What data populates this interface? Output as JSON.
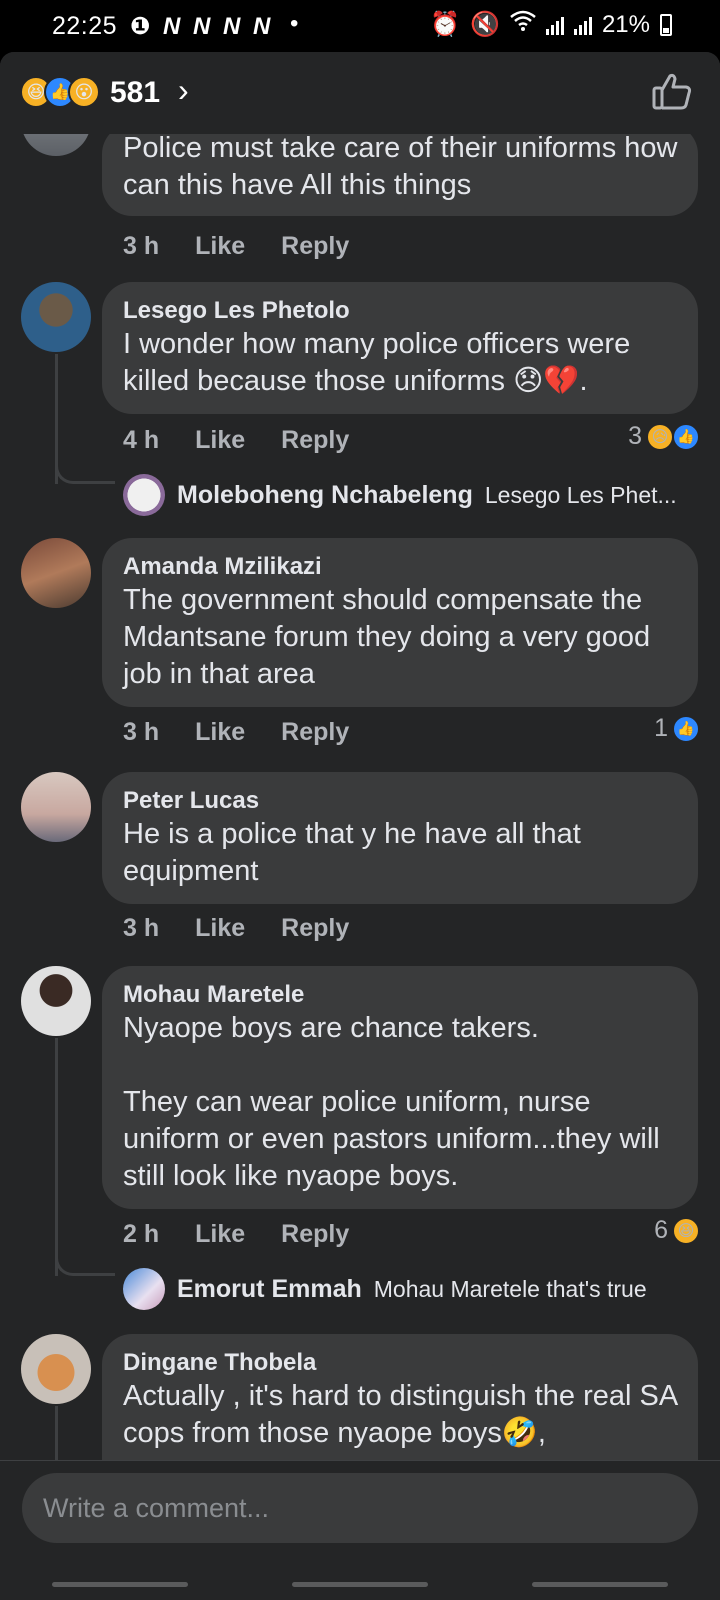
{
  "status_bar": {
    "time": "22:25",
    "notifications": "❶ N N N N",
    "dot": "•",
    "battery": "21%"
  },
  "header": {
    "reactions": [
      "haha-icon",
      "like-icon",
      "wow-icon"
    ],
    "count": "581",
    "chevron": "›"
  },
  "comments": [
    {
      "id": "c0",
      "name": "",
      "text": "Police must take care of their uniforms how can this have All this things",
      "time": "3 h",
      "like": "Like",
      "reply": "Reply"
    },
    {
      "id": "c1",
      "name": "Lesego Les Phetolo",
      "text": "I wonder how many police officers were killed because those uniforms 😞💔.",
      "time": "4 h",
      "like": "Like",
      "reply": "Reply",
      "reaction_count": "3",
      "reply_preview": {
        "name": "Moleboheng Nchabeleng",
        "text": "Lesego Les Phet..."
      }
    },
    {
      "id": "c2",
      "name": "Amanda Mzilikazi",
      "text": "The government should compensate the Mdantsane forum they doing a very good job in that area",
      "time": "3 h",
      "like": "Like",
      "reply": "Reply",
      "reaction_count": "1"
    },
    {
      "id": "c3",
      "name": "Peter Lucas",
      "text": "He is a police that y he have all that equipment",
      "time": "3 h",
      "like": "Like",
      "reply": "Reply"
    },
    {
      "id": "c4",
      "name": "Mohau Maretele",
      "text": "Nyaope boys are chance takers.\n\nThey can wear police uniform, nurse uniform or even pastors uniform...they will still look like nyaope boys.",
      "time": "2 h",
      "like": "Like",
      "reply": "Reply",
      "reaction_count": "6",
      "reply_preview": {
        "name": "Emorut Emmah",
        "text": "Mohau Maretele that's true"
      }
    },
    {
      "id": "c5",
      "name": "Dingane Thobela",
      "text": "Actually , it's hard to distinguish the real SA cops from those nyaope boys🤣,",
      "time": "",
      "like": "",
      "reply": ""
    }
  ],
  "composer": {
    "placeholder": "Write a comment..."
  },
  "colors": {
    "background": "#242526",
    "bubble": "#3a3b3c",
    "text": "#e4e6eb",
    "muted": "#b0b3b8",
    "like_blue": "#2d88ff",
    "emoji_yellow": "#f7b125"
  }
}
